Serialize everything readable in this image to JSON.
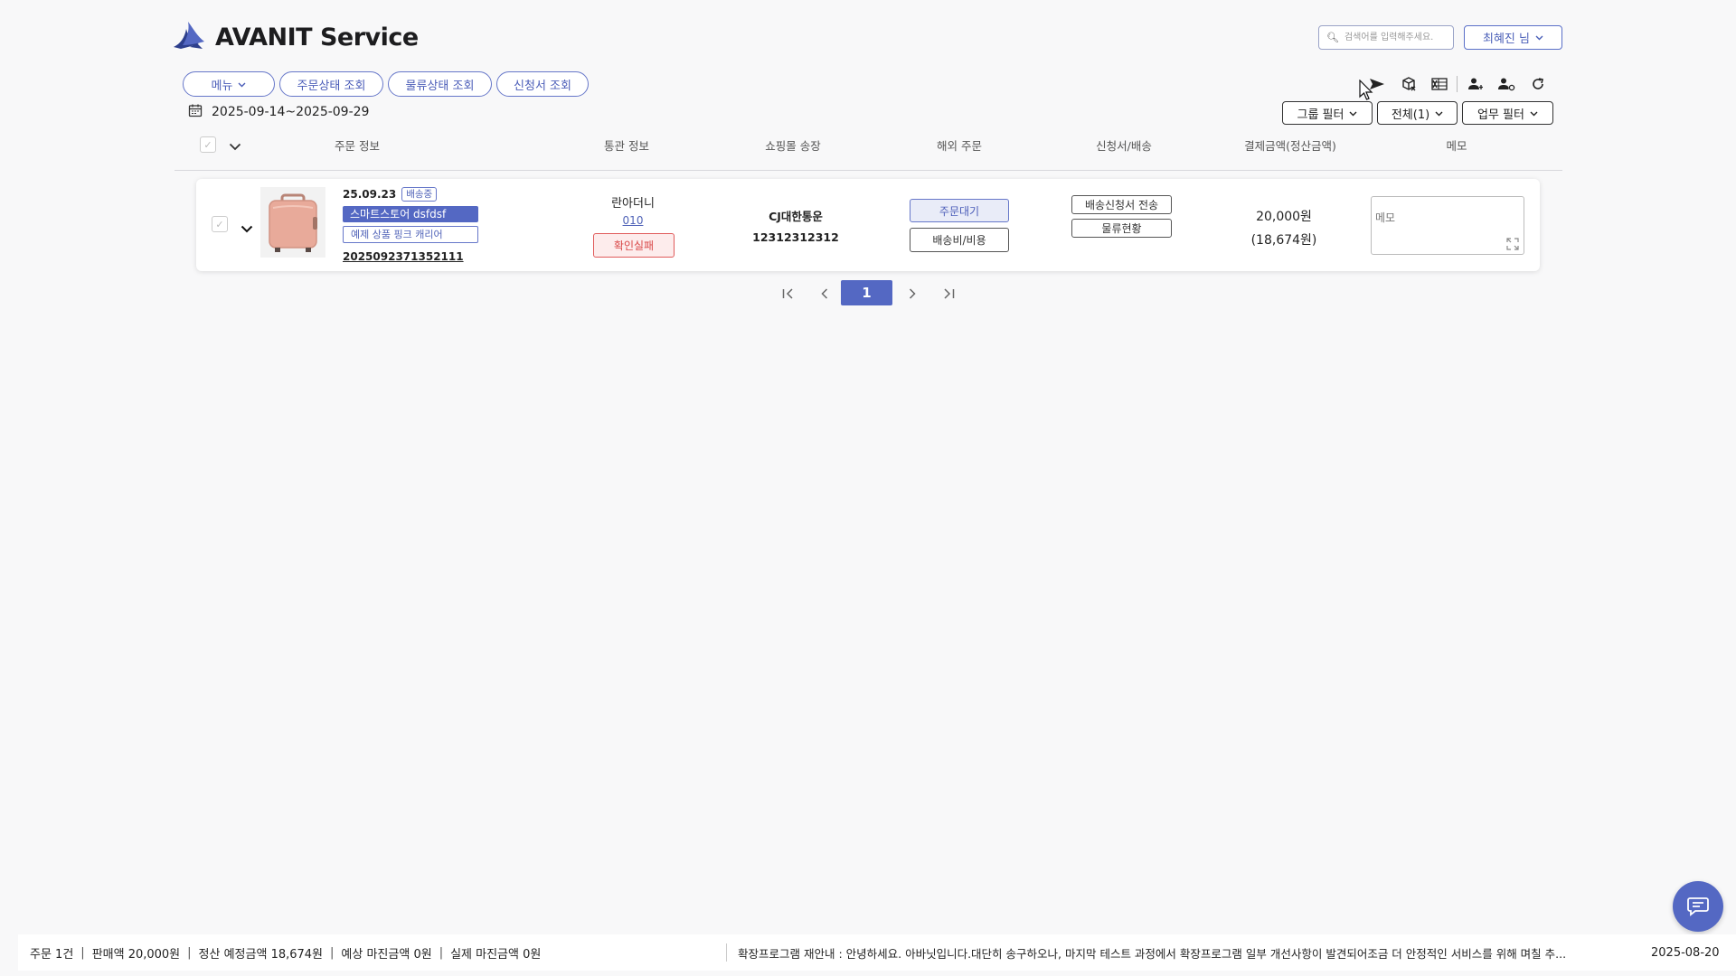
{
  "brand": {
    "name": "AVANIT Service",
    "logo_icon": "swallow-bird-logo"
  },
  "search": {
    "placeholder": "검색어를 입력해주세요."
  },
  "user": {
    "name": "최혜진 님"
  },
  "nav": [
    {
      "label": "메뉴"
    },
    {
      "label": "주문상태 조회"
    },
    {
      "label": "물류상태 조회"
    },
    {
      "label": "신청서 조회"
    }
  ],
  "toolbar_icons": [
    "send-icon",
    "box-close-icon",
    "excel-icon",
    "person-add-icon",
    "person-settings-icon",
    "refresh-icon"
  ],
  "date_range": "2025-09-14~2025-09-29",
  "filters": {
    "group": "그룹 필터",
    "all": "전체(1)",
    "work": "업무 필터"
  },
  "columns": {
    "order_info": "주문 정보",
    "customs_info": "통관 정보",
    "mall_invoice": "쇼핑몰 송장",
    "overseas_order": "해외 주문",
    "application_shipping": "신청서/배송",
    "payment": "결제금액(정산금액)",
    "memo": "메모"
  },
  "order": {
    "date": "25.09.23",
    "status_badge": "배송중",
    "store": "스마트스토어 dsfdsf",
    "product": "예제 상품 핑크 캐리어",
    "order_no": "2025092371352111",
    "customs_name": "란아더니",
    "customs_phone": "010",
    "customs_status": "확인실패",
    "courier": "CJ대한통운",
    "invoice_no": "12312312312",
    "overseas_status": "주문대기",
    "shipping_cost_btn": "배송비/비용",
    "send_application_btn": "배송신청서 전송",
    "logistics_btn": "물류현황",
    "amount": "20,000원",
    "settlement": "(18,674원)",
    "memo_placeholder": "메모"
  },
  "pagination": {
    "current": "1"
  },
  "footer": {
    "summary": [
      "주문 1건",
      "판매액 20,000원",
      "정산 예정금액 18,674원",
      "예상 마진금액 0원",
      "실제 마진금액 0원"
    ],
    "notice": "확장프로그램 재안내 : 안녕하세요. 아바닛입니다.대단히 송구하오나, 마지막 테스트 과정에서 확장프로그램 일부 개선사항이 발견되어조금 더 안정적인 서비스를 위해 며칠 추...",
    "notice_date": "2025-08-20"
  },
  "colors": {
    "accent": "#5468c3",
    "danger": "#e05a5a"
  }
}
